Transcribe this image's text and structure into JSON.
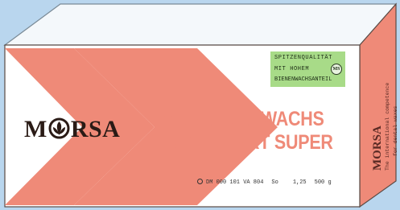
{
  "badge": {
    "line1": "SPITZENQUALITÄT",
    "line2": "MIT HOHEM",
    "line3": "BIENENWACHSANTEIL",
    "seal": "MS"
  },
  "brand": {
    "left": "M",
    "right": "RSA"
  },
  "title": {
    "line1": "MODELLIERWACHS",
    "line2": "EXTRA HART SUPER"
  },
  "article": {
    "code": "DM 000 101 VA 804",
    "unit": "So",
    "weight": "1,25",
    "grams": "500 g"
  },
  "side": {
    "brand": "MORSA",
    "tagline1": "The international competence",
    "tagline2": "for dental waxes"
  },
  "colors": {
    "background": "#b9d6ee",
    "box_face": "#ffffff",
    "box_top": "#f4f8fb",
    "side_panel": "#ef8a78",
    "chevron": "#ef8a78",
    "badge": "#a8db88",
    "title": "#ef8a78"
  },
  "icons": [
    "morsa-logo-icon",
    "quality-seal-icon",
    "ring-icon"
  ]
}
